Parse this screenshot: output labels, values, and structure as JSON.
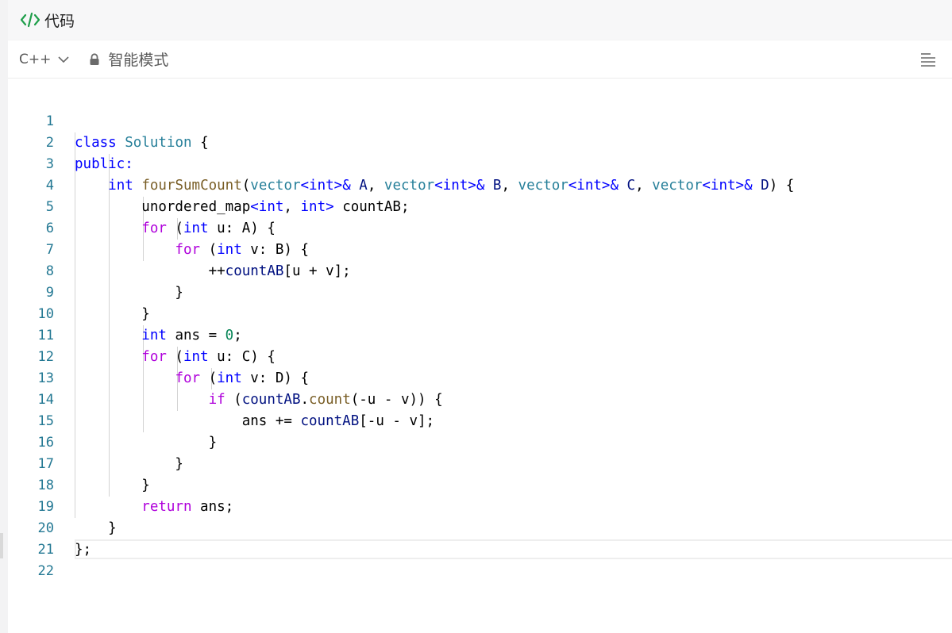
{
  "header": {
    "icon": "code-brackets-icon",
    "title": "代码"
  },
  "toolbar": {
    "language": "C++",
    "mode_label": "智能模式",
    "lock_icon": "lock-icon",
    "menu_icon": "align-left-icon"
  },
  "colors": {
    "keyword": "#0000ff",
    "control": "#af00db",
    "type": "#267f99",
    "function": "#795e26",
    "variable": "#001080",
    "number": "#098658",
    "line_number": "#237893",
    "accent_green": "#1e9e4a"
  },
  "editor": {
    "line_numbers": [
      "1",
      "2",
      "3",
      "4",
      "5",
      "6",
      "7",
      "8",
      "9",
      "10",
      "11",
      "12",
      "13",
      "14",
      "15",
      "16",
      "17",
      "18",
      "19",
      "20",
      "21",
      "22"
    ],
    "lines": [
      "class Solution {",
      "public:",
      "    int fourSumCount(vector<int>& A, vector<int>& B, vector<int>& C, vector<int>& D) {",
      "        unordered_map<int, int> countAB;",
      "        for (int u: A) {",
      "            for (int v: B) {",
      "                ++countAB[u + v];",
      "            }",
      "        }",
      "        int ans = 0;",
      "        for (int u: C) {",
      "            for (int v: D) {",
      "                if (countAB.count(-u - v)) {",
      "                    ans += countAB[-u - v];",
      "                }",
      "            }",
      "        }",
      "        return ans;",
      "    }",
      "};",
      "",
      ""
    ]
  }
}
